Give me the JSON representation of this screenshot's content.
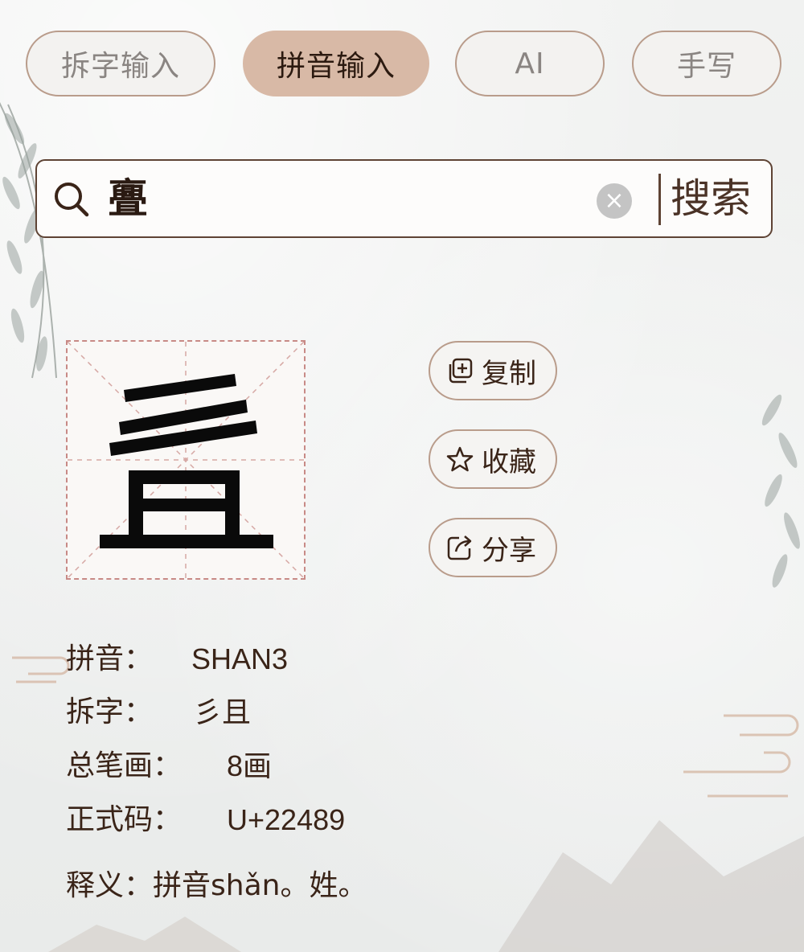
{
  "tabs": [
    {
      "label": "拆字输入",
      "active": false
    },
    {
      "label": "拼音输入",
      "active": true
    },
    {
      "label": "AI",
      "active": false
    },
    {
      "label": "手写",
      "active": false
    }
  ],
  "search": {
    "value": "亹",
    "button_label": "搜索",
    "clear_icon": "×"
  },
  "character": {
    "glyph_name": "彡 over 且"
  },
  "actions": [
    {
      "label": "复制",
      "icon": "copy-icon"
    },
    {
      "label": "收藏",
      "icon": "star-icon"
    },
    {
      "label": "分享",
      "icon": "share-icon"
    }
  ],
  "info": {
    "pinyin_label": "拼音：",
    "pinyin_value": "SHAN3",
    "chaizi_label": "拆字：",
    "chaizi_value": "彡且",
    "strokes_label": "总笔画：",
    "strokes_value": "8画",
    "code_label": "正式码：",
    "code_value": "U+22489",
    "meaning_label": "释义：",
    "meaning_value": "拼音shǎn。姓。"
  },
  "colors": {
    "accent": "#d8b9a6",
    "border": "#b99c8b",
    "text": "#3a2418",
    "grid": "#c88a86"
  }
}
